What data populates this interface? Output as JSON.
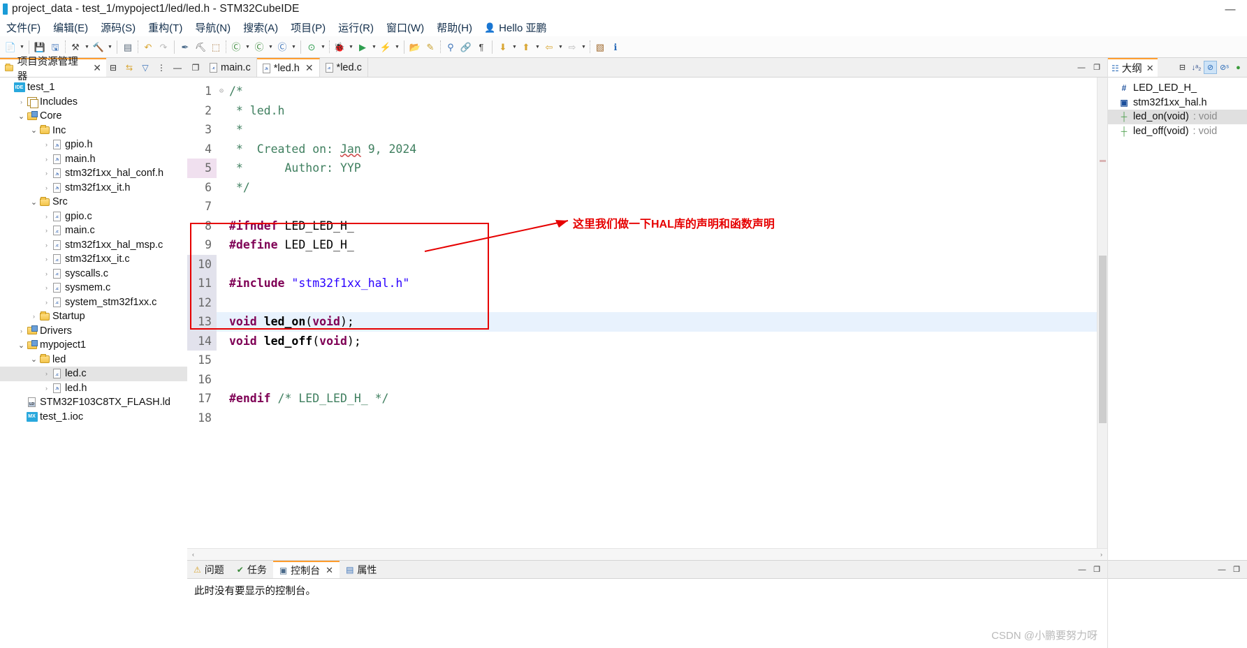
{
  "window": {
    "title": "project_data - test_1/mypoject1/led/led.h - STM32CubeIDE",
    "minimize_label": "—",
    "accent_orange": "#ff9d2e",
    "annotation_red": "#e60000"
  },
  "menubar": {
    "items": [
      {
        "label": "文件(F)"
      },
      {
        "label": "编辑(E)"
      },
      {
        "label": "源码(S)"
      },
      {
        "label": "重构(T)"
      },
      {
        "label": "导航(N)"
      },
      {
        "label": "搜索(A)"
      },
      {
        "label": "项目(P)"
      },
      {
        "label": "运行(R)"
      },
      {
        "label": "窗口(W)"
      },
      {
        "label": "帮助(H)"
      }
    ],
    "user": "Hello 亚鹏"
  },
  "toolbar": {
    "groups": [
      {
        "buttons": [
          {
            "name": "new-button",
            "glyph": "📄",
            "color": "#d8a531",
            "dropdown": true
          }
        ]
      },
      {
        "buttons": [
          {
            "name": "save-button",
            "glyph": "💾",
            "color": "#3b72b8",
            "dropdown": false
          },
          {
            "name": "save-all-button",
            "glyph": "🖫",
            "color": "#3b72b8",
            "dropdown": false
          }
        ]
      },
      {
        "buttons": [
          {
            "name": "build-all-button",
            "glyph": "⚒",
            "color": "#4a4a4a",
            "dropdown": true
          },
          {
            "name": "build-button",
            "glyph": "🔨",
            "color": "#a06a2e",
            "dropdown": true
          }
        ]
      },
      {
        "buttons": [
          {
            "name": "binary-button",
            "glyph": "▤",
            "color": "#5a6a7a",
            "dropdown": false
          }
        ]
      },
      {
        "buttons": [
          {
            "name": "undo-button",
            "glyph": "↶",
            "color": "#d8a531",
            "dropdown": false
          },
          {
            "name": "redo-button",
            "glyph": "↷",
            "color": "#b9b9b9",
            "dropdown": false
          }
        ]
      },
      {
        "buttons": [
          {
            "name": "debug-skip-button",
            "glyph": "✒",
            "color": "#4a6a8a",
            "dropdown": false
          },
          {
            "name": "breakpoint-button",
            "glyph": "⛏",
            "color": "#6a6a6a",
            "dropdown": false
          },
          {
            "name": "export-button",
            "glyph": "⬚",
            "color": "#a06a2e",
            "dropdown": false
          }
        ]
      },
      {
        "buttons": [
          {
            "name": "new-c-project-button",
            "glyph": "Ⓒ",
            "color": "#3a8a3a",
            "dropdown": true
          },
          {
            "name": "new-cpp-class-button",
            "glyph": "Ⓒ",
            "color": "#3a8a3a",
            "dropdown": true
          },
          {
            "name": "new-source-file-button",
            "glyph": "Ⓒ",
            "color": "#3b72b8",
            "dropdown": true
          }
        ]
      },
      {
        "buttons": [
          {
            "name": "run-config-button",
            "glyph": "⊙",
            "color": "#2e9e4f",
            "dropdown": true
          }
        ]
      },
      {
        "buttons": [
          {
            "name": "debug-button",
            "glyph": "🐞",
            "color": "#5b8a3a",
            "dropdown": true
          },
          {
            "name": "run-button",
            "glyph": "▶",
            "color": "#2e9e4f",
            "dropdown": true
          },
          {
            "name": "debug-as-button",
            "glyph": "⚡",
            "color": "#c8a02e",
            "dropdown": true
          }
        ]
      },
      {
        "buttons": [
          {
            "name": "open-resource-button",
            "glyph": "📂",
            "color": "#d8a531",
            "dropdown": false
          },
          {
            "name": "pencil-button",
            "glyph": "✎",
            "color": "#c8a02e",
            "dropdown": false
          }
        ]
      },
      {
        "buttons": [
          {
            "name": "search-button",
            "glyph": "⚲",
            "color": "#3b72b8",
            "dropdown": false
          },
          {
            "name": "link-button",
            "glyph": "🔗",
            "color": "#6a6a6a",
            "dropdown": false
          },
          {
            "name": "paragraph-button",
            "glyph": "¶",
            "color": "#4a4a4a",
            "dropdown": false
          }
        ]
      },
      {
        "buttons": [
          {
            "name": "next-annotation-button",
            "glyph": "⬇",
            "color": "#d8a531",
            "dropdown": true
          },
          {
            "name": "prev-annotation-button",
            "glyph": "⬆",
            "color": "#d8a531",
            "dropdown": true
          },
          {
            "name": "back-button",
            "glyph": "⇦",
            "color": "#d8a531",
            "dropdown": true
          },
          {
            "name": "forward-button",
            "glyph": "⇨",
            "color": "#b9b9b9",
            "dropdown": true
          }
        ]
      },
      {
        "buttons": [
          {
            "name": "pin-editor-button",
            "glyph": "▧",
            "color": "#a06a2e",
            "dropdown": false
          },
          {
            "name": "info-button",
            "glyph": "ℹ",
            "color": "#2a6bb8",
            "dropdown": false
          }
        ]
      }
    ]
  },
  "project_explorer": {
    "tab_label": "项目资源管理器",
    "close_label": "✕",
    "icons": [
      {
        "name": "collapse-all-icon",
        "glyph": "⊟"
      },
      {
        "name": "link-with-editor-icon",
        "glyph": "⇆"
      },
      {
        "name": "view-filter-icon",
        "glyph": "▽"
      },
      {
        "name": "view-menu-icon",
        "glyph": "⋮"
      },
      {
        "name": "minimize-view-icon",
        "glyph": "—"
      }
    ],
    "tree": [
      {
        "label": "test_1",
        "depth": 0,
        "twist": "",
        "icon": "ide",
        "selected": false
      },
      {
        "label": "Includes",
        "depth": 1,
        "twist": "›",
        "icon": "includes",
        "selected": false
      },
      {
        "label": "Core",
        "depth": 1,
        "twist": "⌄",
        "icon": "folder-src",
        "selected": false
      },
      {
        "label": "Inc",
        "depth": 2,
        "twist": "⌄",
        "icon": "folder",
        "selected": false
      },
      {
        "label": "gpio.h",
        "depth": 3,
        "twist": "›",
        "icon": "file-h",
        "selected": false
      },
      {
        "label": "main.h",
        "depth": 3,
        "twist": "›",
        "icon": "file-h",
        "selected": false
      },
      {
        "label": "stm32f1xx_hal_conf.h",
        "depth": 3,
        "twist": "›",
        "icon": "file-h",
        "selected": false
      },
      {
        "label": "stm32f1xx_it.h",
        "depth": 3,
        "twist": "›",
        "icon": "file-h",
        "selected": false
      },
      {
        "label": "Src",
        "depth": 2,
        "twist": "⌄",
        "icon": "folder",
        "selected": false
      },
      {
        "label": "gpio.c",
        "depth": 3,
        "twist": "›",
        "icon": "file-c",
        "selected": false
      },
      {
        "label": "main.c",
        "depth": 3,
        "twist": "›",
        "icon": "file-c",
        "selected": false
      },
      {
        "label": "stm32f1xx_hal_msp.c",
        "depth": 3,
        "twist": "›",
        "icon": "file-c",
        "selected": false
      },
      {
        "label": "stm32f1xx_it.c",
        "depth": 3,
        "twist": "›",
        "icon": "file-c",
        "selected": false
      },
      {
        "label": "syscalls.c",
        "depth": 3,
        "twist": "›",
        "icon": "file-c",
        "selected": false
      },
      {
        "label": "sysmem.c",
        "depth": 3,
        "twist": "›",
        "icon": "file-c",
        "selected": false
      },
      {
        "label": "system_stm32f1xx.c",
        "depth": 3,
        "twist": "›",
        "icon": "file-c",
        "selected": false
      },
      {
        "label": "Startup",
        "depth": 2,
        "twist": "›",
        "icon": "folder",
        "selected": false
      },
      {
        "label": "Drivers",
        "depth": 1,
        "twist": "›",
        "icon": "folder-src",
        "selected": false
      },
      {
        "label": "mypoject1",
        "depth": 1,
        "twist": "⌄",
        "icon": "folder-src",
        "selected": false
      },
      {
        "label": "led",
        "depth": 2,
        "twist": "⌄",
        "icon": "folder",
        "selected": false
      },
      {
        "label": "led.c",
        "depth": 3,
        "twist": "›",
        "icon": "file-c",
        "selected": true
      },
      {
        "label": "led.h",
        "depth": 3,
        "twist": "›",
        "icon": "file-h",
        "selected": false
      },
      {
        "label": "STM32F103C8TX_FLASH.ld",
        "depth": 1,
        "twist": "",
        "icon": "ld",
        "selected": false
      },
      {
        "label": "test_1.ioc",
        "depth": 1,
        "twist": "",
        "icon": "mx",
        "selected": false
      }
    ]
  },
  "editor": {
    "restore_icon": "❐",
    "tabs": [
      {
        "label": "main.c",
        "icon": "file-c",
        "active": false,
        "dirty": false,
        "closable": false
      },
      {
        "label": "*led.h",
        "icon": "file-h",
        "active": true,
        "dirty": true,
        "closable": true
      },
      {
        "label": "*led.c",
        "icon": "file-c",
        "active": false,
        "dirty": true,
        "closable": false
      }
    ],
    "close_label": "✕",
    "right_icons": [
      {
        "name": "minimize-editor-icon",
        "glyph": "—"
      },
      {
        "name": "maximize-editor-icon",
        "glyph": "❐"
      }
    ],
    "current_line": 13,
    "bookmark_line": 5,
    "lines": [
      {
        "n": 1,
        "fold": "⊝",
        "tokens": [
          {
            "t": "/*",
            "c": "cmt"
          }
        ]
      },
      {
        "n": 2,
        "fold": "",
        "tokens": [
          {
            "t": " * led.h",
            "c": "cmt"
          }
        ]
      },
      {
        "n": 3,
        "fold": "",
        "tokens": [
          {
            "t": " *",
            "c": "cmt"
          }
        ]
      },
      {
        "n": 4,
        "fold": "",
        "tokens": [
          {
            "t": " *  Created on: ",
            "c": "cmt"
          },
          {
            "t": "Jan",
            "c": "cmt-sq"
          },
          {
            "t": " 9, 2024",
            "c": "cmt"
          }
        ]
      },
      {
        "n": 5,
        "fold": "",
        "tokens": [
          {
            "t": " *      Author: YYP",
            "c": "cmt"
          }
        ]
      },
      {
        "n": 6,
        "fold": "",
        "tokens": [
          {
            "t": " */",
            "c": "cmt"
          }
        ]
      },
      {
        "n": 7,
        "fold": "",
        "tokens": []
      },
      {
        "n": 8,
        "fold": "",
        "tokens": [
          {
            "t": "#ifndef",
            "c": "pp"
          },
          {
            "t": " LED_LED_H_",
            "c": "pl"
          }
        ]
      },
      {
        "n": 9,
        "fold": "",
        "tokens": [
          {
            "t": "#define",
            "c": "pp"
          },
          {
            "t": " LED_LED_H_",
            "c": "pl"
          }
        ]
      },
      {
        "n": 10,
        "fold": "",
        "tokens": []
      },
      {
        "n": 11,
        "fold": "",
        "tokens": [
          {
            "t": "#include",
            "c": "pp"
          },
          {
            "t": " ",
            "c": "pl"
          },
          {
            "t": "\"stm32f1xx_hal.h\"",
            "c": "str"
          }
        ]
      },
      {
        "n": 12,
        "fold": "",
        "tokens": []
      },
      {
        "n": 13,
        "fold": "",
        "tokens": [
          {
            "t": "void",
            "c": "kw"
          },
          {
            "t": " ",
            "c": "pl"
          },
          {
            "t": "led_on",
            "c": "fn"
          },
          {
            "t": "(",
            "c": "pl"
          },
          {
            "t": "void",
            "c": "kw"
          },
          {
            "t": ");",
            "c": "pl"
          }
        ]
      },
      {
        "n": 14,
        "fold": "",
        "tokens": [
          {
            "t": "void",
            "c": "kw"
          },
          {
            "t": " ",
            "c": "pl"
          },
          {
            "t": "led_off",
            "c": "fn"
          },
          {
            "t": "(",
            "c": "pl"
          },
          {
            "t": "void",
            "c": "kw"
          },
          {
            "t": ");",
            "c": "pl"
          }
        ]
      },
      {
        "n": 15,
        "fold": "",
        "tokens": []
      },
      {
        "n": 16,
        "fold": "",
        "tokens": []
      },
      {
        "n": 17,
        "fold": "",
        "tokens": [
          {
            "t": "#endif",
            "c": "pp"
          },
          {
            "t": " ",
            "c": "pl"
          },
          {
            "t": "/* LED_LED_H_ */",
            "c": "cmt"
          }
        ]
      },
      {
        "n": 18,
        "fold": "",
        "tokens": []
      }
    ],
    "annotation": {
      "text": "这里我们做一下HAL库的声明和函数声明",
      "color": "#e60000"
    },
    "hscroll": {
      "left_arrow": "‹",
      "right_arrow": "›"
    }
  },
  "console": {
    "tabs": [
      {
        "label": "问题",
        "icon": "problems",
        "active": false,
        "closable": false
      },
      {
        "label": "任务",
        "icon": "tasks",
        "active": false,
        "closable": false
      },
      {
        "label": "控制台",
        "icon": "console",
        "active": true,
        "closable": true
      },
      {
        "label": "属性",
        "icon": "properties",
        "active": false,
        "closable": false
      }
    ],
    "close_label": "✕",
    "message": "此时没有要显示的控制台。",
    "right_icons": [
      {
        "name": "minimize-console-icon",
        "glyph": "—"
      },
      {
        "name": "maximize-console-icon",
        "glyph": "❐"
      }
    ],
    "watermark": "CSDN @小鹏要努力呀"
  },
  "outline": {
    "tab_label": "大纲",
    "close_label": "✕",
    "icons": [
      {
        "name": "collapse-all-icon",
        "glyph": "⊟",
        "active": false
      },
      {
        "name": "sort-icon",
        "glyph": "↓ᵃ₂",
        "active": false
      },
      {
        "name": "hide-fields-icon",
        "glyph": "⊘",
        "active": true
      },
      {
        "name": "hide-static-icon",
        "glyph": "⊘ˢ",
        "active": false
      },
      {
        "name": "hide-nonpublic-icon",
        "glyph": "●",
        "active": false
      }
    ],
    "items": [
      {
        "label": "LED_LED_H_",
        "type": "",
        "icon": "macro",
        "selected": false
      },
      {
        "label": "stm32f1xx_hal.h",
        "type": "",
        "icon": "include",
        "selected": false
      },
      {
        "label": "led_on(void)",
        "type": " : void",
        "icon": "function",
        "selected": true
      },
      {
        "label": "led_off(void)",
        "type": " : void",
        "icon": "function",
        "selected": false
      }
    ],
    "bottom_icons": [
      {
        "name": "minimize-outline-icon",
        "glyph": "—"
      },
      {
        "name": "maximize-outline-icon",
        "glyph": "❐"
      }
    ]
  }
}
